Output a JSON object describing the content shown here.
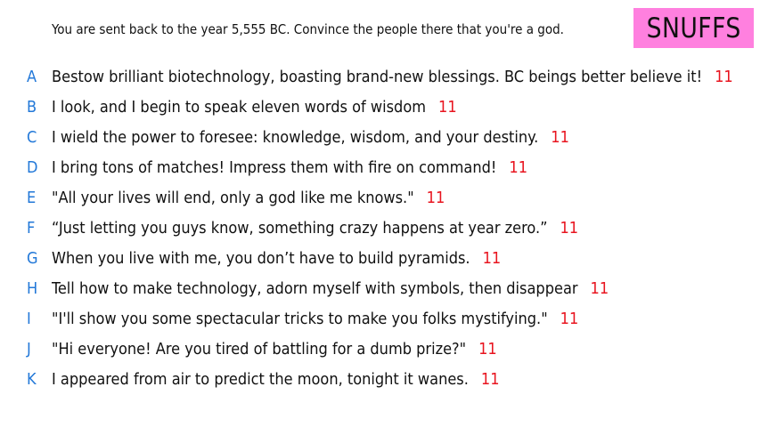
{
  "prompt": "You are sent back to the year 5,555 BC. Convince the people there that you're a god.",
  "badge": "SNUFFS",
  "colors": {
    "badge_background": "#ff80df",
    "letter": "#2278d8",
    "score": "#e8141f",
    "text": "#111111"
  },
  "answers": [
    {
      "letter": "A",
      "text": "Bestow brilliant biotechnology, boasting brand-new blessings. BC beings better believe it!",
      "score": "11"
    },
    {
      "letter": "B",
      "text": "I look, and I begin to speak eleven words of wisdom",
      "score": "11"
    },
    {
      "letter": "C",
      "text": "I wield the power to foresee: knowledge, wisdom, and your destiny.",
      "score": "11"
    },
    {
      "letter": "D",
      "text": "I bring tons of matches! Impress them with fire on command!",
      "score": "11"
    },
    {
      "letter": "E",
      "text": "\"All your lives will end, only a god like me knows.\"",
      "score": "11"
    },
    {
      "letter": "F",
      "text": "“Just letting you guys know, something crazy happens at year zero.”",
      "score": "11"
    },
    {
      "letter": "G",
      "text": "When you live with me, you don’t have to build pyramids.",
      "score": "11"
    },
    {
      "letter": "H",
      "text": "Tell how to make technology, adorn myself with symbols, then disappear",
      "score": "11"
    },
    {
      "letter": "I",
      "text": "\"I'll show you some spectacular tricks to make you folks mystifying.\"",
      "score": "11"
    },
    {
      "letter": "J",
      "text": "\"Hi everyone! Are you tired of battling for a dumb prize?\"",
      "score": "11"
    },
    {
      "letter": "K",
      "text": "I appeared from air to predict the moon, tonight it wanes.",
      "score": "11"
    }
  ]
}
